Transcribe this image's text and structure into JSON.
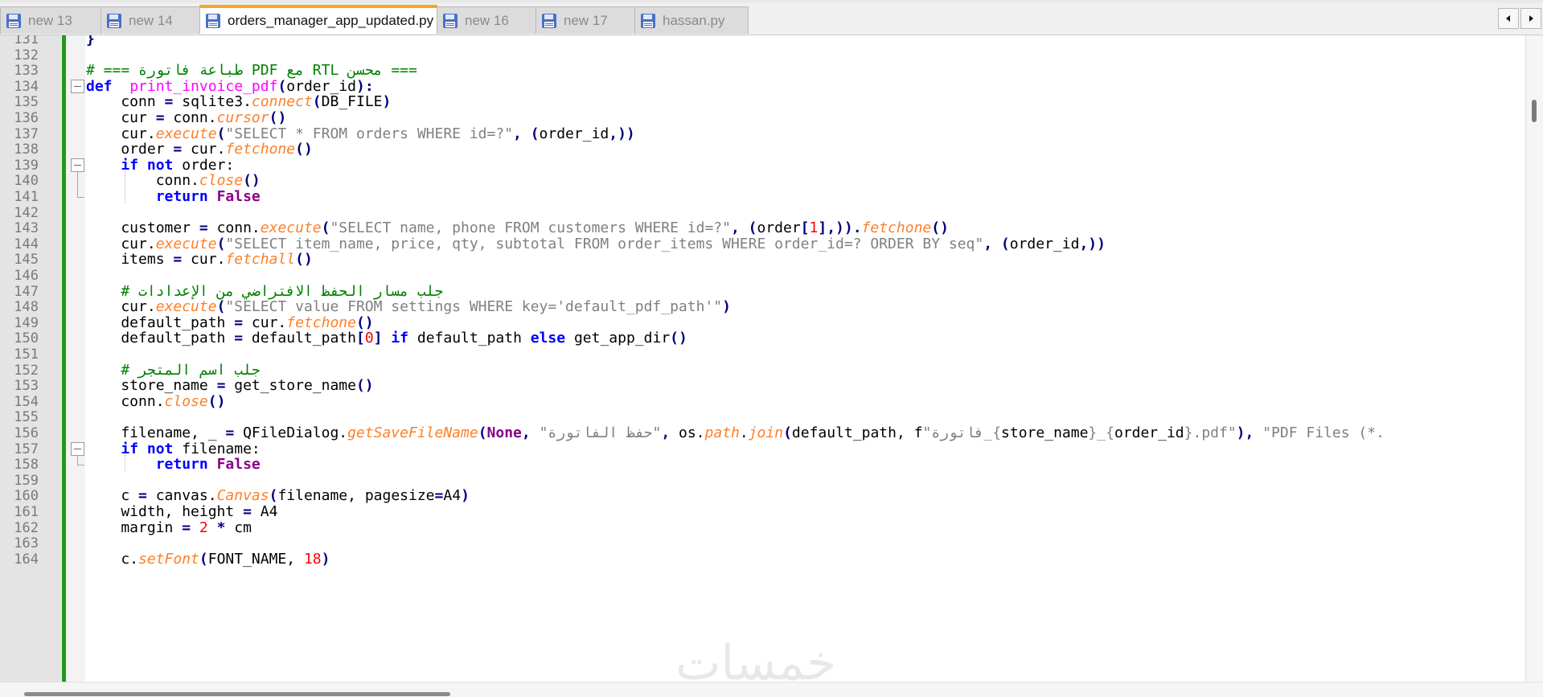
{
  "tabs": [
    {
      "label": "new 13",
      "active": false
    },
    {
      "label": "new 14",
      "active": false
    },
    {
      "label": "orders_manager_app_updated.py",
      "active": true
    },
    {
      "label": "new 16",
      "active": false
    },
    {
      "label": "new 17",
      "active": false
    },
    {
      "label": "hassan.py",
      "active": false
    }
  ],
  "colors": {
    "accent": "#f5a623",
    "change_bar": "#1f9b1f",
    "keyword": "#0000ff",
    "string": "#808080",
    "comment": "#008000",
    "method": "#ff7f27"
  },
  "icons": [
    "save-disk-icon",
    "pin-icon",
    "close-icon",
    "scroll-left-icon",
    "scroll-right-icon"
  ],
  "watermark": "خمسات",
  "lines": [
    {
      "n": "131",
      "code": [
        [
          "op",
          "}"
        ]
      ]
    },
    {
      "n": "132",
      "code": []
    },
    {
      "n": "133",
      "code": [
        [
          "cm",
          "# === طباعة فاتورة PDF مع RTL محسن ==="
        ]
      ]
    },
    {
      "n": "134",
      "code": [
        [
          "kw",
          "def"
        ],
        [
          "",
          "  "
        ],
        [
          "fn",
          "print_invoice_pdf"
        ],
        [
          "op",
          "("
        ],
        [
          "",
          "order_id"
        ],
        [
          "op",
          "):"
        ]
      ]
    },
    {
      "n": "135",
      "code": [
        [
          "",
          "    conn "
        ],
        [
          "op",
          "="
        ],
        [
          "",
          " sqlite3."
        ],
        [
          "mth",
          "connect"
        ],
        [
          "op",
          "("
        ],
        [
          "",
          "DB_FILE"
        ],
        [
          "op",
          ")"
        ]
      ]
    },
    {
      "n": "136",
      "code": [
        [
          "",
          "    cur "
        ],
        [
          "op",
          "="
        ],
        [
          "",
          " conn."
        ],
        [
          "mth",
          "cursor"
        ],
        [
          "op",
          "()"
        ]
      ]
    },
    {
      "n": "137",
      "code": [
        [
          "",
          "    cur."
        ],
        [
          "mth",
          "execute"
        ],
        [
          "op",
          "("
        ],
        [
          "str",
          "\"SELECT * FROM orders WHERE id=?\""
        ],
        [
          "op",
          ", ("
        ],
        [
          "",
          "order_id"
        ],
        [
          "op",
          ",))"
        ]
      ]
    },
    {
      "n": "138",
      "code": [
        [
          "",
          "    order "
        ],
        [
          "op",
          "="
        ],
        [
          "",
          " cur."
        ],
        [
          "mth",
          "fetchone"
        ],
        [
          "op",
          "()"
        ]
      ]
    },
    {
      "n": "139",
      "code": [
        [
          "",
          "    "
        ],
        [
          "kw",
          "if not"
        ],
        [
          "",
          " order:"
        ]
      ]
    },
    {
      "n": "140",
      "code": [
        [
          "",
          "        conn."
        ],
        [
          "mth",
          "close"
        ],
        [
          "op",
          "()"
        ]
      ]
    },
    {
      "n": "141",
      "code": [
        [
          "",
          "        "
        ],
        [
          "kw",
          "return"
        ],
        [
          "",
          " "
        ],
        [
          "kw2",
          "False"
        ]
      ]
    },
    {
      "n": "142",
      "code": []
    },
    {
      "n": "143",
      "code": [
        [
          "",
          "    customer "
        ],
        [
          "op",
          "="
        ],
        [
          "",
          " conn."
        ],
        [
          "mth",
          "execute"
        ],
        [
          "op",
          "("
        ],
        [
          "str",
          "\"SELECT name, phone FROM customers WHERE id=?\""
        ],
        [
          "op",
          ", ("
        ],
        [
          "",
          "order"
        ],
        [
          "op",
          "["
        ],
        [
          "num",
          "1"
        ],
        [
          "op",
          "],))."
        ],
        [
          "mth",
          "fetchone"
        ],
        [
          "op",
          "()"
        ]
      ]
    },
    {
      "n": "144",
      "code": [
        [
          "",
          "    cur."
        ],
        [
          "mth",
          "execute"
        ],
        [
          "op",
          "("
        ],
        [
          "str",
          "\"SELECT item_name, price, qty, subtotal FROM order_items WHERE order_id=? ORDER BY seq\""
        ],
        [
          "op",
          ", ("
        ],
        [
          "",
          "order_id"
        ],
        [
          "op",
          ",))"
        ]
      ]
    },
    {
      "n": "145",
      "code": [
        [
          "",
          "    items "
        ],
        [
          "op",
          "="
        ],
        [
          "",
          " cur."
        ],
        [
          "mth",
          "fetchall"
        ],
        [
          "op",
          "()"
        ]
      ]
    },
    {
      "n": "146",
      "code": []
    },
    {
      "n": "147",
      "code": [
        [
          "",
          "    "
        ],
        [
          "cm",
          "# جلب مسار الحفظ الافتراضي من الإعدادات"
        ]
      ]
    },
    {
      "n": "148",
      "code": [
        [
          "",
          "    cur."
        ],
        [
          "mth",
          "execute"
        ],
        [
          "op",
          "("
        ],
        [
          "str",
          "\"SELECT value FROM settings WHERE key='default_pdf_path'\""
        ],
        [
          "op",
          ")"
        ]
      ]
    },
    {
      "n": "149",
      "code": [
        [
          "",
          "    default_path "
        ],
        [
          "op",
          "="
        ],
        [
          "",
          " cur."
        ],
        [
          "mth",
          "fetchone"
        ],
        [
          "op",
          "()"
        ]
      ]
    },
    {
      "n": "150",
      "code": [
        [
          "",
          "    default_path "
        ],
        [
          "op",
          "="
        ],
        [
          "",
          " default_path"
        ],
        [
          "op",
          "["
        ],
        [
          "num",
          "0"
        ],
        [
          "op",
          "]"
        ],
        [
          "",
          " "
        ],
        [
          "kw",
          "if"
        ],
        [
          "",
          " default_path "
        ],
        [
          "kw",
          "else"
        ],
        [
          "",
          " get_app_dir"
        ],
        [
          "op",
          "()"
        ]
      ]
    },
    {
      "n": "151",
      "code": []
    },
    {
      "n": "152",
      "code": [
        [
          "",
          "    "
        ],
        [
          "cm",
          "# جلب اسم المتجر"
        ]
      ]
    },
    {
      "n": "153",
      "code": [
        [
          "",
          "    store_name "
        ],
        [
          "op",
          "="
        ],
        [
          "",
          " get_store_name"
        ],
        [
          "op",
          "()"
        ]
      ]
    },
    {
      "n": "154",
      "code": [
        [
          "",
          "    conn."
        ],
        [
          "mth",
          "close"
        ],
        [
          "op",
          "()"
        ]
      ]
    },
    {
      "n": "155",
      "code": []
    },
    {
      "n": "156",
      "code": [
        [
          "",
          "    filename, _ "
        ],
        [
          "op",
          "="
        ],
        [
          "",
          " QFileDialog."
        ],
        [
          "mth",
          "getSaveFileName"
        ],
        [
          "op",
          "("
        ],
        [
          "kw2",
          "None"
        ],
        [
          "op",
          ", "
        ],
        [
          "str",
          "\"حفظ الفاتورة\""
        ],
        [
          "op",
          ", "
        ],
        [
          "",
          "os."
        ],
        [
          "mth",
          "path"
        ],
        [
          "",
          "."
        ],
        [
          "mth",
          "join"
        ],
        [
          "op",
          "("
        ],
        [
          "",
          "default_path, f"
        ],
        [
          "str",
          "\"فاتورة_{"
        ],
        [
          "",
          "store_name"
        ],
        [
          "str",
          "}_{"
        ],
        [
          "",
          "order_id"
        ],
        [
          "str",
          "}.pdf\""
        ],
        [
          "op",
          "), "
        ],
        [
          "str",
          "\"PDF Files (*."
        ]
      ]
    },
    {
      "n": "157",
      "code": [
        [
          "",
          "    "
        ],
        [
          "kw",
          "if not"
        ],
        [
          "",
          " filename:"
        ]
      ]
    },
    {
      "n": "158",
      "code": [
        [
          "",
          "        "
        ],
        [
          "kw",
          "return"
        ],
        [
          "",
          " "
        ],
        [
          "kw2",
          "False"
        ]
      ]
    },
    {
      "n": "159",
      "code": []
    },
    {
      "n": "160",
      "code": [
        [
          "",
          "    c "
        ],
        [
          "op",
          "="
        ],
        [
          "",
          " canvas."
        ],
        [
          "mth",
          "Canvas"
        ],
        [
          "op",
          "("
        ],
        [
          "",
          "filename, pagesize"
        ],
        [
          "op",
          "="
        ],
        [
          "",
          "A4"
        ],
        [
          "op",
          ")"
        ]
      ]
    },
    {
      "n": "161",
      "code": [
        [
          "",
          "    width, height "
        ],
        [
          "op",
          "="
        ],
        [
          "",
          " A4"
        ]
      ]
    },
    {
      "n": "162",
      "code": [
        [
          "",
          "    margin "
        ],
        [
          "op",
          "="
        ],
        [
          "",
          " "
        ],
        [
          "num",
          "2"
        ],
        [
          "",
          " "
        ],
        [
          "op",
          "*"
        ],
        [
          "",
          " cm"
        ]
      ]
    },
    {
      "n": "163",
      "code": []
    },
    {
      "n": "164",
      "code": [
        [
          "",
          "    c."
        ],
        [
          "mth",
          "setFont"
        ],
        [
          "op",
          "("
        ],
        [
          "",
          "FONT_NAME, "
        ],
        [
          "num",
          "18"
        ],
        [
          "op",
          ")"
        ]
      ]
    }
  ]
}
